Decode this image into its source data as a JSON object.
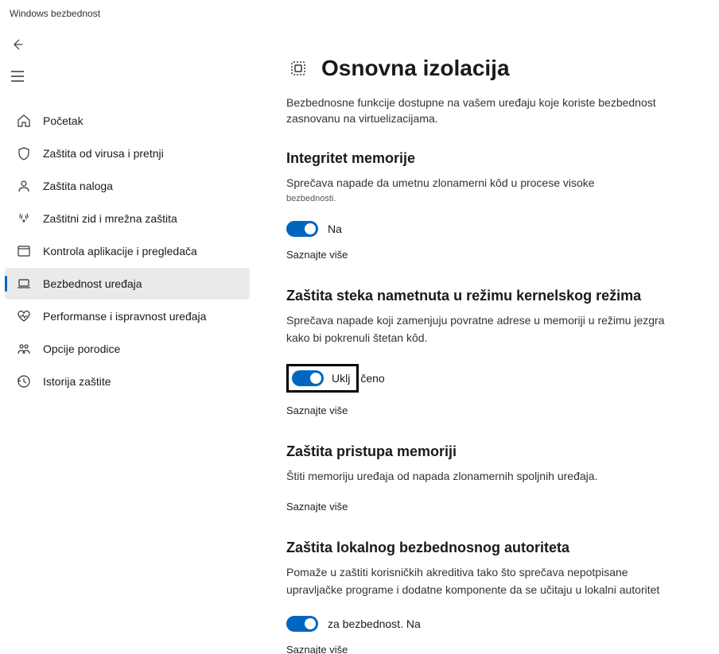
{
  "appTitle": "Windows bezbednost",
  "nav": {
    "items": [
      {
        "label": "Početak"
      },
      {
        "label": "Zaštita od virusa i pretnji"
      },
      {
        "label": "Zaštita naloga"
      },
      {
        "label": "Zaštitni zid i mrežna zaštita"
      },
      {
        "label": "Kontrola aplikacije i pregledača"
      },
      {
        "label": "Bezbednost uređaja"
      },
      {
        "label": "Performanse i ispravnost uređaja"
      },
      {
        "label": "Opcije porodice"
      },
      {
        "label": "Istorija zaštite"
      }
    ]
  },
  "page": {
    "title": "Osnovna izolacija",
    "desc": "Bezbednosne funkcije dostupne na vašem uređaju koje koriste bezbednost zasnovanu na virtuelizacijama."
  },
  "sections": {
    "memIntegrity": {
      "title": "Integritet memorije",
      "desc": "Sprečava napade da umetnu zlonamerni kôd u procese visoke",
      "descSmall": "bezbednosti.",
      "toggleLabel": "Na",
      "learnMore": "Saznajte više"
    },
    "kernelStack": {
      "title": "Zaštita steka nametnuta u režimu kernelskog režima",
      "desc": "Sprečava napade koji zamenjuju povratne adrese u memoriji u režimu jezgra kako bi pokrenuli štetan kôd.",
      "toggleLabelPart1": "Uklj",
      "toggleLabelPart2": "čeno",
      "learnMore": "Saznajte više"
    },
    "memAccess": {
      "title": "Zaštita pristupa memoriji",
      "desc": "Štiti memoriju uređaja od napada zlonamernih spoljnih uređaja.",
      "learnMore": "Saznajte više"
    },
    "lsa": {
      "title": "Zaštita lokalnog bezbednosnog autoriteta",
      "desc": "Pomaže u zaštiti korisničkih akreditiva tako što sprečava nepotpisane upravljačke programe i dodatne komponente da se učitaju u lokalni autoritet",
      "toggleLabel": "za bezbednost. Na",
      "learnMore": "Saznajte više"
    }
  }
}
